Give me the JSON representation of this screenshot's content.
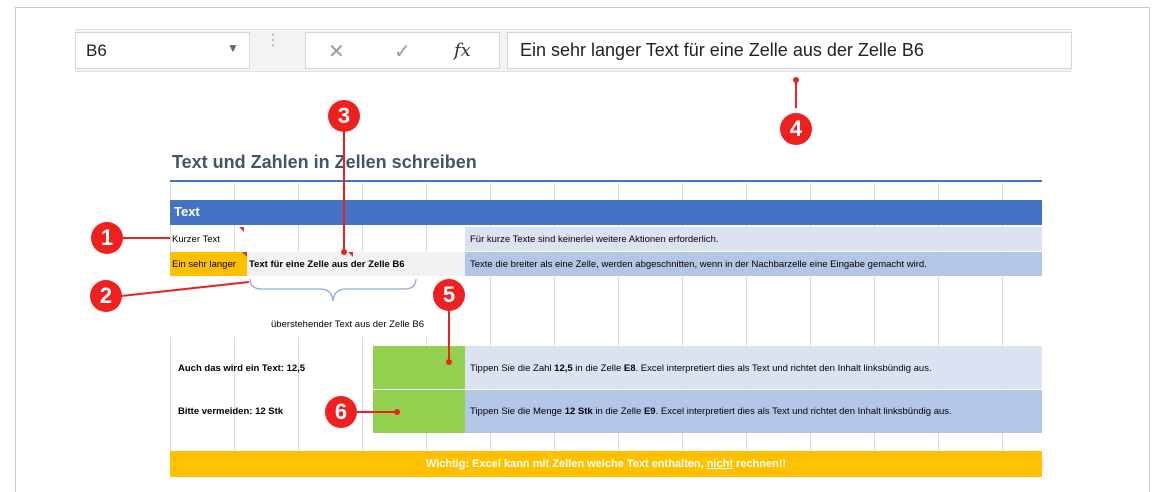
{
  "formula_bar": {
    "name_box": "B6",
    "name_box_arrow": "▼",
    "more_dots": "⋮",
    "cancel": "✕",
    "enter": "✓",
    "fx": "fx",
    "formula": "Ein sehr langer Text für eine Zelle aus der Zelle B6"
  },
  "sheet": {
    "title": "Text und Zahlen in Zellen schreiben",
    "section_header": "Text",
    "rows": {
      "r1_left": "Kurzer Text",
      "r1_desc": "Für kurze Texte sind keinerlei weitere Aktionen erforderlich.",
      "r2_left_a": "Ein sehr langer",
      "r2_left_b": "Text für eine Zelle aus der Zelle B6",
      "r2_desc": "Texte die breiter als eine Zelle, werden abgeschnitten, wenn in der Nachbarzelle eine Eingabe gemacht wird.",
      "brace_label": "überstehender Text aus der Zelle B6",
      "r3_left": "Auch das wird ein Text: 12,5",
      "r3_desc_a": "Tippen Sie die Zahl ",
      "r3_desc_b": "12,5",
      "r3_desc_c": " in die Zelle ",
      "r3_desc_d": "E8",
      "r3_desc_e": ". Excel interpretiert dies als Text und richtet den Inhalt linksbündig aus.",
      "r4_left": "Bitte vermeiden: 12 Stk",
      "r4_desc_a": "Tippen Sie die Menge ",
      "r4_desc_b": "12 Stk",
      "r4_desc_c": " in die Zelle ",
      "r4_desc_d": "E9",
      "r4_desc_e": ". Excel interpretiert dies als Text und richtet den Inhalt linksbündig aus."
    },
    "footer_a": "Wichtig: Excel kann mit Zellen welche Text enthalten, ",
    "footer_b": "nicht",
    "footer_c": " rechnen!!"
  },
  "callouts": [
    "1",
    "2",
    "3",
    "4",
    "5",
    "6"
  ],
  "colors": {
    "accent_blue": "#4472c4",
    "callout_red": "#ee2020",
    "orange": "#ffc000",
    "green": "#92d050"
  }
}
